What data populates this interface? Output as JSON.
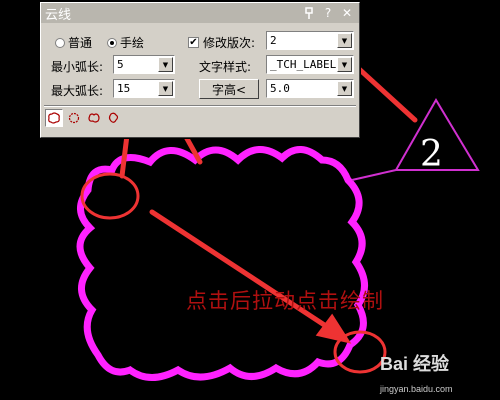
{
  "dialog": {
    "title": "云线",
    "mode_options": [
      {
        "label": "普通",
        "selected": false
      },
      {
        "label": "手绘",
        "selected": true
      }
    ],
    "revision": {
      "label": "修改版次:",
      "checked": true,
      "value": "2"
    },
    "min_arc": {
      "label": "最小弧长:",
      "value": "5"
    },
    "max_arc": {
      "label": "最大弧长:",
      "value": "15"
    },
    "text_style": {
      "label": "文字样式:",
      "value": "_TCH_LABEL"
    },
    "text_height": {
      "button_label": "字高<",
      "value": "5.0"
    }
  },
  "canvas": {
    "instruction_text": "点击后拉动点击绘制",
    "revision_marker": "2"
  },
  "watermark": {
    "brand": "Bai 经验",
    "url": "jingyan.baidu.com"
  },
  "colors": {
    "cloud": "#ff22ff",
    "arrow": "#ee3333",
    "text": "#b01010",
    "dialog_bg": "#d4d0c8"
  }
}
